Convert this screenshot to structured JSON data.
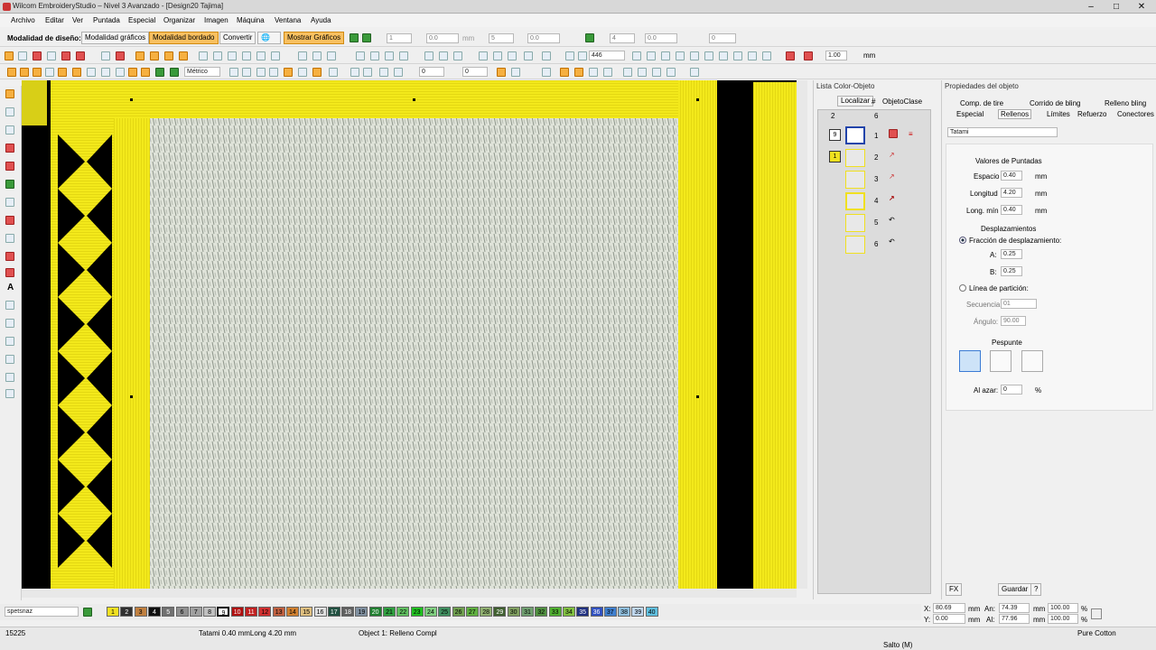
{
  "window": {
    "title": "Wilcom EmbroideryStudio – Nivel 3 Avanzado - [Design20       Tajima]"
  },
  "menu": [
    "Archivo",
    "Editar",
    "Ver",
    "Puntada",
    "Especial",
    "Organizar",
    "Imagen",
    "Máquina",
    "Ventana",
    "Ayuda"
  ],
  "toolbar1": {
    "mode_label": "Modalidad de diseño:",
    "graphics_mode": "Modalidad gráficos",
    "embroidery_mode": "Modalidad bordado",
    "convert": "Convertir",
    "show_graphics": "Mostrar Gráficos",
    "f1": "1",
    "f2": "0.0",
    "u1": "mm",
    "f3": "5",
    "f4": "0.0",
    "f5": "4",
    "f6": "0.0",
    "f7": "0"
  },
  "toolbar2": {
    "zoom": "446",
    "scale": "1.00",
    "unit": "mm"
  },
  "toolbar3": {
    "metric": "Métrico",
    "a1": "0",
    "a2": "0"
  },
  "color_panel": {
    "title": "Lista Color-Objeto",
    "locate": "Localizar",
    "hash": "#",
    "objclass": "ObjetoClase",
    "col1": "2",
    "col2": "6",
    "rows": [
      {
        "n": "1",
        "sel": "9"
      },
      {
        "n": "2",
        "sel": "1"
      },
      {
        "n": "3"
      },
      {
        "n": "4"
      },
      {
        "n": "5"
      },
      {
        "n": "6"
      }
    ]
  },
  "props": {
    "title": "Propiedades del objeto",
    "tabs_row1": [
      "Comp. de tire",
      "Corrido de bling",
      "Relleno bling"
    ],
    "tabs_row2": [
      "Especial",
      "Rellenos",
      "Límites",
      "Refuerzo",
      "Conectores"
    ],
    "fill_type": "Tatami",
    "section_values": "Valores de Puntadas",
    "spacing_label": "Espacio",
    "spacing": "0.40",
    "length_label": "Longitud",
    "length": "4.20",
    "minlen_label": "Long. mín",
    "minlen": "0.40",
    "mm": "mm",
    "offsets": "Desplazamientos",
    "offset_frac": "Fracción de desplazamiento:",
    "a_label": "A:",
    "a": "0.25",
    "b_label": "B:",
    "b": "0.25",
    "partition": "Línea de partición:",
    "seq_label": "Secuencia",
    "seq": "01",
    "angle_label": "Ángulo:",
    "angle": "90.00",
    "backstitch": "Pespunte",
    "random_label": "Al azar:",
    "random": "0",
    "pct": "%",
    "fx": "FX",
    "save": "Guardar",
    "help": "?"
  },
  "palette": {
    "thread": "spetsnaz",
    "swatches": [
      {
        "n": "1",
        "c": "#f0e020"
      },
      {
        "n": "2",
        "c": "#303030"
      },
      {
        "n": "3",
        "c": "#c08040"
      },
      {
        "n": "4",
        "c": "#101010"
      },
      {
        "n": "5",
        "c": "#707070"
      },
      {
        "n": "6",
        "c": "#909090"
      },
      {
        "n": "7",
        "c": "#a0a0a0"
      },
      {
        "n": "8",
        "c": "#c0c0c0"
      },
      {
        "n": "9",
        "c": "#ffffff"
      },
      {
        "n": "10",
        "c": "#b01010"
      },
      {
        "n": "11",
        "c": "#c02020"
      },
      {
        "n": "12",
        "c": "#d03030"
      },
      {
        "n": "13",
        "c": "#c06040"
      },
      {
        "n": "14",
        "c": "#d08030"
      },
      {
        "n": "15",
        "c": "#e0c080"
      },
      {
        "n": "16",
        "c": "#e0e0e0"
      },
      {
        "n": "17",
        "c": "#205040"
      },
      {
        "n": "18",
        "c": "#606060"
      },
      {
        "n": "19",
        "c": "#8090a0"
      },
      {
        "n": "20",
        "c": "#208030"
      },
      {
        "n": "21",
        "c": "#30a040"
      },
      {
        "n": "22",
        "c": "#60c060"
      },
      {
        "n": "23",
        "c": "#20c020"
      },
      {
        "n": "24",
        "c": "#80d080"
      },
      {
        "n": "25",
        "c": "#409060"
      },
      {
        "n": "26",
        "c": "#70a050"
      },
      {
        "n": "27",
        "c": "#60b040"
      },
      {
        "n": "28",
        "c": "#90b070"
      },
      {
        "n": "29",
        "c": "#406030"
      },
      {
        "n": "30",
        "c": "#80a060"
      },
      {
        "n": "31",
        "c": "#70a070"
      },
      {
        "n": "32",
        "c": "#509040"
      },
      {
        "n": "33",
        "c": "#50b030"
      },
      {
        "n": "34",
        "c": "#80c040"
      },
      {
        "n": "35",
        "c": "#203080"
      },
      {
        "n": "36",
        "c": "#3050c0"
      },
      {
        "n": "37",
        "c": "#4080d0"
      },
      {
        "n": "38",
        "c": "#90c0e0"
      },
      {
        "n": "39",
        "c": "#c0d8f0"
      },
      {
        "n": "40",
        "c": "#60c0e0"
      }
    ]
  },
  "coords": {
    "x_label": "X:",
    "x": "80.69",
    "y_label": "Y:",
    "y": "0.00",
    "an_label": "An:",
    "an": "74.39",
    "al_label": "Al:",
    "al": "77.96",
    "mm": "mm",
    "p1": "100.00",
    "p2": "100.00",
    "pct": "%"
  },
  "status": {
    "stitches": "15225",
    "info": "Tatami 0.40 mmLong 4.20 mm",
    "object": "Object 1: Relleno Compl",
    "jump": "Salto (M)",
    "fabric": "Pure Cotton"
  },
  "colors": {
    "yellow": "#f2e81a",
    "fill": "#d6dcd0"
  }
}
